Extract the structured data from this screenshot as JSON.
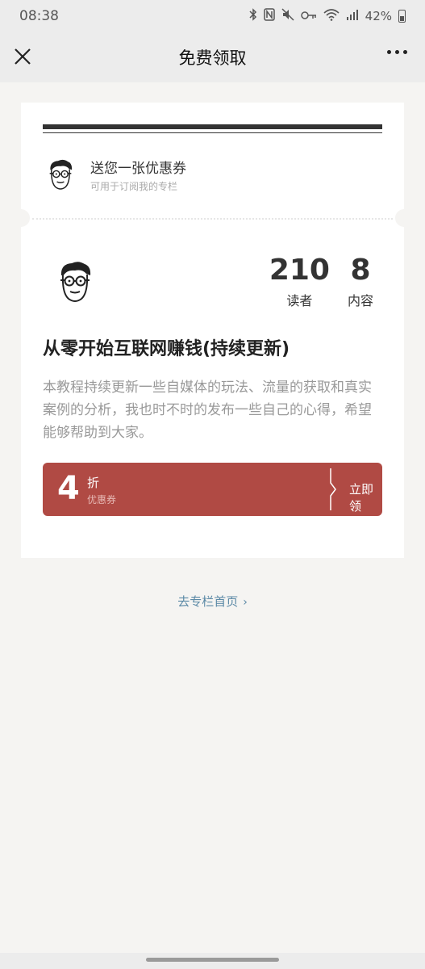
{
  "status_bar": {
    "time": "08:38",
    "battery_text": "42%",
    "icons": [
      "bluetooth-icon",
      "nfc-icon",
      "mute-icon",
      "key-icon",
      "wifi-icon",
      "signal-icon",
      "battery-icon"
    ]
  },
  "nav": {
    "title": "免费领取"
  },
  "coupon": {
    "title": "送您一张优惠券",
    "subtitle": "可用于订阅我的专栏"
  },
  "column": {
    "stats": [
      {
        "value": "210",
        "label": "读者"
      },
      {
        "value": "8",
        "label": "内容"
      }
    ],
    "title": "从零开始互联网赚钱(持续更新)",
    "description": "本教程持续更新一些自媒体的玩法、流量的获取和真实案例的分析，我也时不时的发布一些自己的心得，希望能够帮助到大家。"
  },
  "claim": {
    "discount": "4",
    "unit": "折",
    "label": "优惠券",
    "action": "立即领"
  },
  "footer": {
    "go_home": "去专栏首页"
  },
  "colors": {
    "accent": "#b04a44",
    "link": "#5b89a6",
    "background": "#f5f4f2"
  }
}
